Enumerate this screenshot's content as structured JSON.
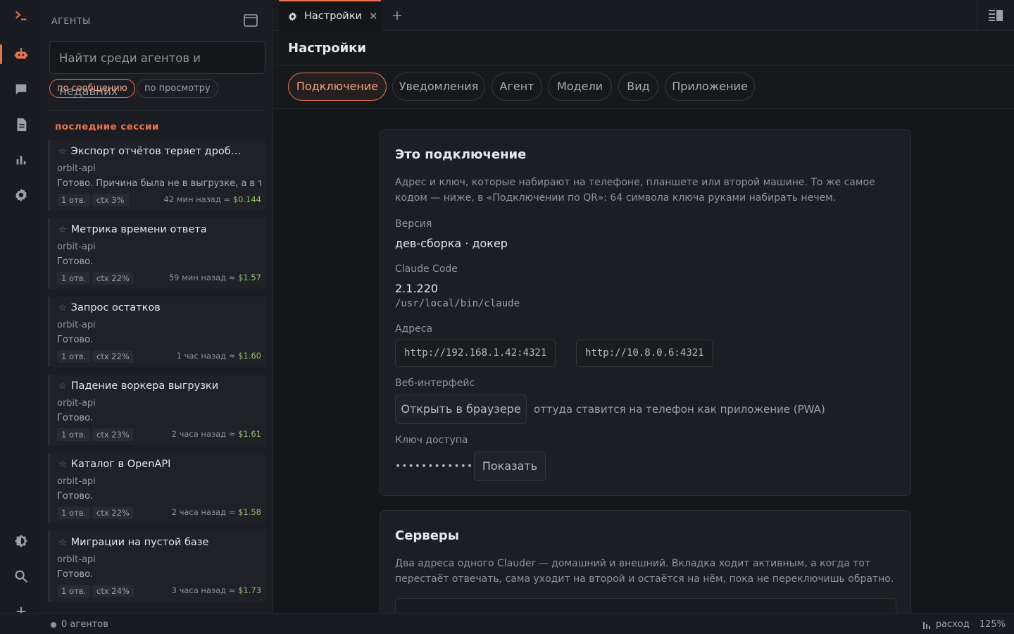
{
  "sidebar": {
    "header": "АГЕНТЫ",
    "search_placeholder": "Найти среди агентов и недавних",
    "filters": [
      "по сообщению",
      "по просмотру"
    ],
    "sessions_label": "последние сессии",
    "sessions": [
      {
        "title": "Экспорт отчётов теряет дроб…",
        "project": "orbit-api",
        "summary": "Готово. Причина была не в выгрузке, а в ти…",
        "replies": "1 отв.",
        "ctx": "ctx 3%",
        "time": "42 мин назад ≈",
        "cost": "$0.144"
      },
      {
        "title": "Метрика времени ответа",
        "project": "orbit-api",
        "summary": "Готово.",
        "replies": "1 отв.",
        "ctx": "ctx 22%",
        "time": "59 мин назад ≈",
        "cost": "$1.57"
      },
      {
        "title": "Запрос остатков",
        "project": "orbit-api",
        "summary": "Готово.",
        "replies": "1 отв.",
        "ctx": "ctx 22%",
        "time": "1 час назад ≈",
        "cost": "$1.60"
      },
      {
        "title": "Падение воркера выгрузки",
        "project": "orbit-api",
        "summary": "Готово.",
        "replies": "1 отв.",
        "ctx": "ctx 23%",
        "time": "2 часа назад ≈",
        "cost": "$1.61"
      },
      {
        "title": "Каталог в OpenAPI",
        "project": "orbit-api",
        "summary": "Готово.",
        "replies": "1 отв.",
        "ctx": "ctx 22%",
        "time": "2 часа назад ≈",
        "cost": "$1.58"
      },
      {
        "title": "Миграции на пустой базе",
        "project": "orbit-api",
        "summary": "Готово.",
        "replies": "1 отв.",
        "ctx": "ctx 24%",
        "time": "3 часа назад ≈",
        "cost": "$1.73"
      }
    ]
  },
  "tabs": {
    "active_label": "Настройки",
    "close": "✕",
    "add": "+"
  },
  "page": {
    "title": "Настройки"
  },
  "subtabs": [
    "Подключение",
    "Уведомления",
    "Агент",
    "Модели",
    "Вид",
    "Приложение"
  ],
  "connection": {
    "title": "Это подключение",
    "description": "Адрес и ключ, которые набирают на телефоне, планшете или второй машине. То же самое кодом — ниже, в «Подключении по QR»: 64 символа ключа руками набирать нечем.",
    "version_label": "Версия",
    "version_value": "дев-сборка · докер",
    "claude_label": "Claude Code",
    "claude_version": "2.1.220",
    "claude_path": "/usr/local/bin/claude",
    "addresses_label": "Адреса",
    "addresses": [
      "http://192.168.1.42:4321",
      "http://10.8.0.6:4321"
    ],
    "web_label": "Веб-интерфейс",
    "open_browser": "Открыть в браузере",
    "web_hint": "оттуда ставится на телефон как приложение (PWA)",
    "key_label": "Ключ доступа",
    "key_masked": "••••••••••••••••",
    "show": "Показать"
  },
  "servers": {
    "title": "Серверы",
    "description": "Два адреса одного Clauder — домашний и внешний. Вкладка ходит активным, а когда тот перестаёт отвечать, сама уходит на второй и остаётся на нём, пока не переключишь обратно."
  },
  "status": {
    "agents": "0 агентов",
    "cost": "расход",
    "zoom": "125%"
  },
  "colors": {
    "accent": "#e8734f",
    "cost": "#8fbf6f"
  }
}
